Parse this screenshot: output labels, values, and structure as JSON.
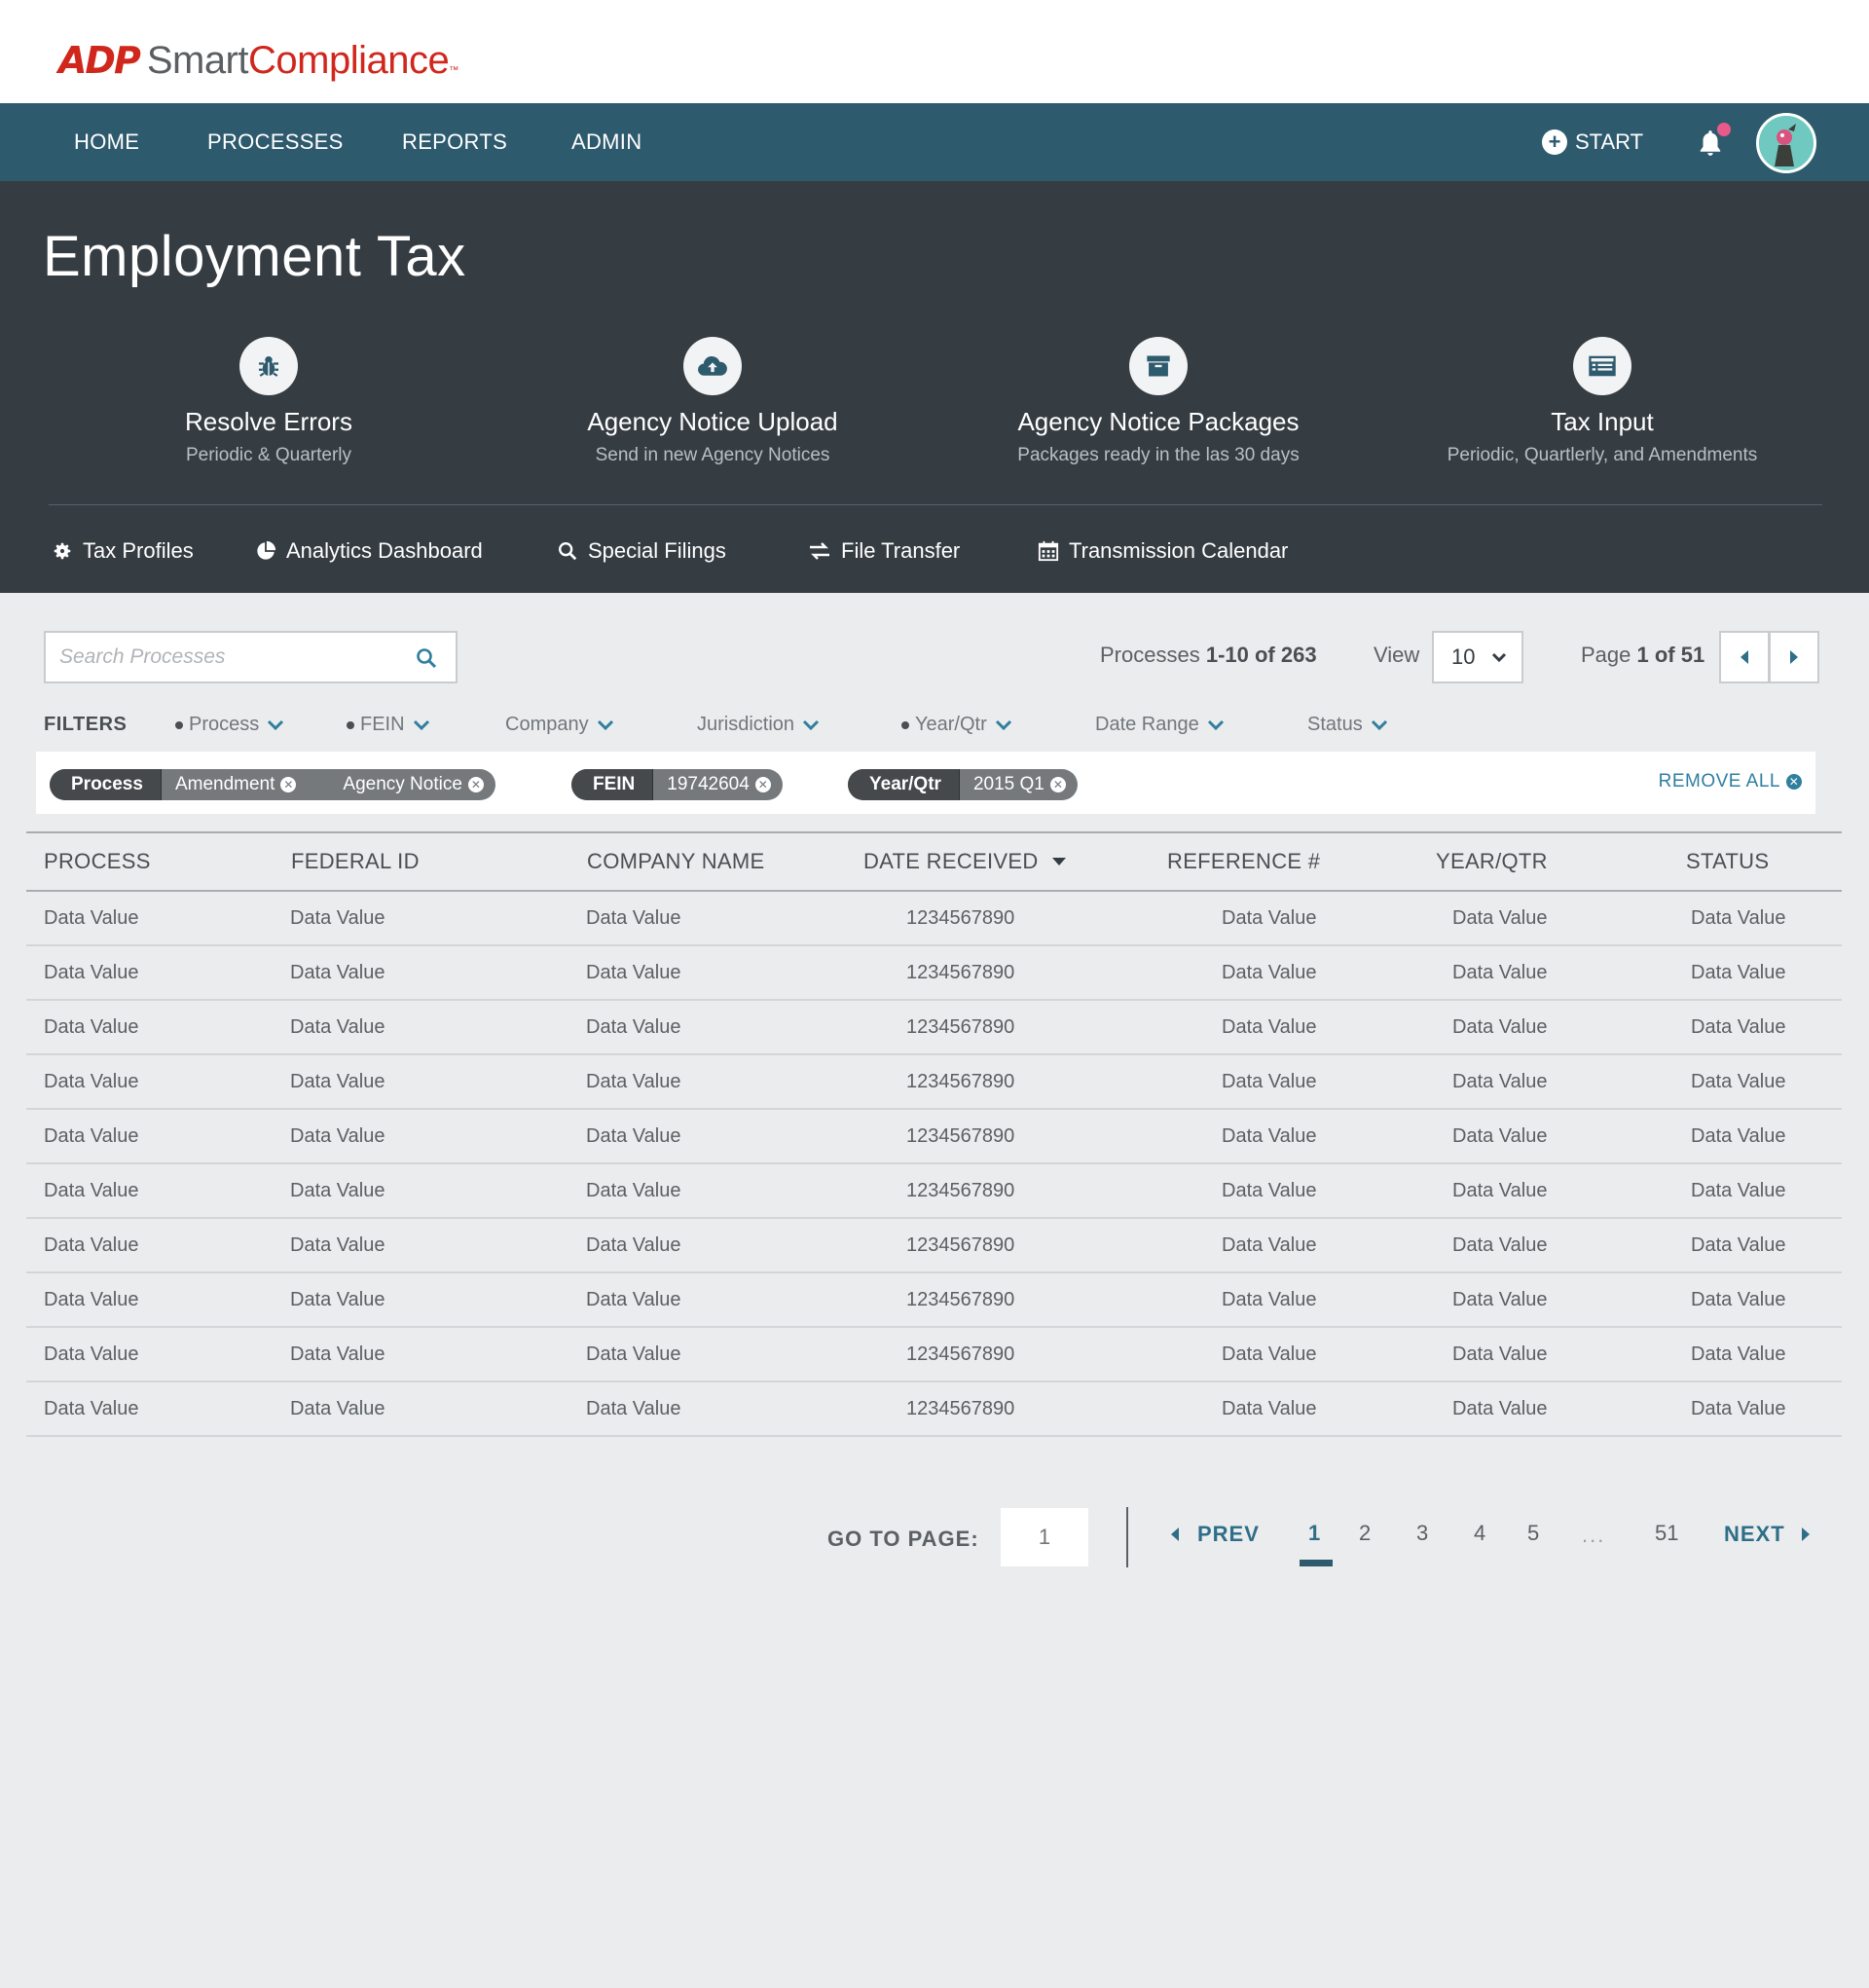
{
  "brand": {
    "adp": "ADP",
    "smart": "Smart",
    "compliance": "Compliance",
    "tm": "™"
  },
  "nav": {
    "items": [
      "HOME",
      "PROCESSES",
      "REPORTS",
      "ADMIN"
    ],
    "start_label": "START"
  },
  "hero": {
    "title": "Employment Tax",
    "tiles": [
      {
        "title": "Resolve Errors",
        "subtitle": "Periodic & Quarterly",
        "icon": "bug-icon"
      },
      {
        "title": "Agency Notice Upload",
        "subtitle": "Send in new Agency Notices",
        "icon": "cloud-upload-icon"
      },
      {
        "title": "Agency Notice Packages",
        "subtitle": "Packages ready in the las 30 days",
        "icon": "archive-box-icon"
      },
      {
        "title": "Tax Input",
        "subtitle": "Periodic, Quartlerly, and Amendments",
        "icon": "form-list-icon"
      }
    ],
    "quick_links": [
      {
        "label": "Tax Profiles",
        "icon": "gear-icon"
      },
      {
        "label": "Analytics Dashboard",
        "icon": "pie-chart-icon"
      },
      {
        "label": "Special Filings",
        "icon": "search-icon"
      },
      {
        "label": "File Transfer",
        "icon": "transfer-arrows-icon"
      },
      {
        "label": "Transmission Calendar",
        "icon": "calendar-icon"
      }
    ]
  },
  "controls": {
    "search_placeholder": "Search Processes",
    "count_prefix": "Processes ",
    "count_range": "1-10 of 263",
    "view_label": "View",
    "view_value": "10",
    "page_prefix": "Page ",
    "page_value": "1 of 51"
  },
  "filters": {
    "label": "FILTERS",
    "items": [
      {
        "label": "Process",
        "active": true
      },
      {
        "label": "FEIN",
        "active": true
      },
      {
        "label": "Company",
        "active": false
      },
      {
        "label": "Jurisdiction",
        "active": false
      },
      {
        "label": "Year/Qtr",
        "active": true
      },
      {
        "label": "Date Range",
        "active": false
      },
      {
        "label": "Status",
        "active": false
      }
    ],
    "chips": [
      {
        "key": "Process",
        "values": [
          "Amendment",
          "Agency Notice"
        ]
      },
      {
        "key": "FEIN",
        "values": [
          "19742604"
        ]
      },
      {
        "key": "Year/Qtr",
        "values": [
          "2015 Q1"
        ]
      }
    ],
    "remove_all": "REMOVE ALL"
  },
  "table": {
    "columns": [
      "PROCESS",
      "FEDERAL ID",
      "COMPANY NAME",
      "DATE RECEIVED",
      "REFERENCE #",
      "YEAR/QTR",
      "STATUS"
    ],
    "sorted_column": "DATE RECEIVED",
    "rows": [
      [
        "Data Value",
        "Data Value",
        "Data Value",
        "1234567890",
        "Data Value",
        "Data Value",
        "Data Value"
      ],
      [
        "Data Value",
        "Data Value",
        "Data Value",
        "1234567890",
        "Data Value",
        "Data Value",
        "Data Value"
      ],
      [
        "Data Value",
        "Data Value",
        "Data Value",
        "1234567890",
        "Data Value",
        "Data Value",
        "Data Value"
      ],
      [
        "Data Value",
        "Data Value",
        "Data Value",
        "1234567890",
        "Data Value",
        "Data Value",
        "Data Value"
      ],
      [
        "Data Value",
        "Data Value",
        "Data Value",
        "1234567890",
        "Data Value",
        "Data Value",
        "Data Value"
      ],
      [
        "Data Value",
        "Data Value",
        "Data Value",
        "1234567890",
        "Data Value",
        "Data Value",
        "Data Value"
      ],
      [
        "Data Value",
        "Data Value",
        "Data Value",
        "1234567890",
        "Data Value",
        "Data Value",
        "Data Value"
      ],
      [
        "Data Value",
        "Data Value",
        "Data Value",
        "1234567890",
        "Data Value",
        "Data Value",
        "Data Value"
      ],
      [
        "Data Value",
        "Data Value",
        "Data Value",
        "1234567890",
        "Data Value",
        "Data Value",
        "Data Value"
      ],
      [
        "Data Value",
        "Data Value",
        "Data Value",
        "1234567890",
        "Data Value",
        "Data Value",
        "Data Value"
      ]
    ]
  },
  "pagination": {
    "goto_label": "GO TO PAGE:",
    "goto_placeholder": "1",
    "prev": "PREV",
    "next": "NEXT",
    "pages": [
      "1",
      "2",
      "3",
      "4",
      "5"
    ],
    "ellipsis": "...",
    "last": "51",
    "current": "1"
  },
  "colors": {
    "brand_red": "#d0271d",
    "nav_bg": "#2e5a6e",
    "hero_bg": "#353c42",
    "link": "#2e6e88",
    "notification": "#e85a8a"
  }
}
